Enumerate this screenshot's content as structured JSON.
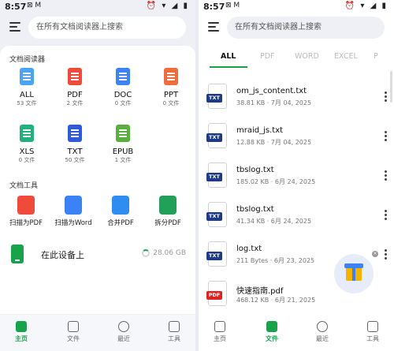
{
  "left": {
    "status": {
      "time": "8:57",
      "indicators": "⊠ M",
      "icons": "⏰ ▾ ◢ ▮"
    },
    "search_placeholder": "在所有文档阅读器上搜索",
    "readers_title": "文档阅读器",
    "categories": [
      {
        "label": "ALL",
        "count": "53 文件",
        "color": "#4aa3f5",
        "icon": "all-docs-icon"
      },
      {
        "label": "PDF",
        "count": "2 文件",
        "color": "#f04a3a",
        "icon": "pdf-icon"
      },
      {
        "label": "DOC",
        "count": "0 文件",
        "color": "#3b82f6",
        "icon": "doc-icon"
      },
      {
        "label": "PPT",
        "count": "0 文件",
        "color": "#f26b3a",
        "icon": "ppt-icon"
      },
      {
        "label": "XLS",
        "count": "0 文件",
        "color": "#22b07d",
        "icon": "xls-icon"
      },
      {
        "label": "TXT",
        "count": "50 文件",
        "color": "#2f5bd6",
        "icon": "txt-icon"
      },
      {
        "label": "EPUB",
        "count": "1 文件",
        "color": "#56b03a",
        "icon": "epub-icon"
      }
    ],
    "tools_title": "文档工具",
    "tools": [
      {
        "label": "扫描为PDF",
        "color": "#f04a3a",
        "icon": "scan-pdf-icon"
      },
      {
        "label": "扫描为Word",
        "color": "#3b82f6",
        "icon": "scan-word-icon"
      },
      {
        "label": "合并PDF",
        "color": "#2f8cf0",
        "icon": "merge-pdf-icon"
      },
      {
        "label": "拆分PDF",
        "color": "#22a05a",
        "icon": "split-pdf-icon"
      }
    ],
    "device": {
      "label": "在此设备上",
      "size": "28.06 GB"
    },
    "nav": [
      {
        "label": "主页",
        "active": true
      },
      {
        "label": "文件",
        "active": false
      },
      {
        "label": "最近",
        "active": false
      },
      {
        "label": "工具",
        "active": false
      }
    ]
  },
  "right": {
    "status": {
      "time": "8:57",
      "indicators": "⊠ M",
      "icons": "⏰ ▾ ◢ ▮"
    },
    "search_placeholder": "在所有文档阅读器上搜索",
    "tabs": [
      "ALL",
      "PDF",
      "WORD",
      "EXCEL",
      "P"
    ],
    "files": [
      {
        "name": "om_js_content.txt",
        "meta": "38.81 KB · 7月 04, 2025",
        "type": "TXT",
        "color": "#1e3a8a"
      },
      {
        "name": "mraid_js.txt",
        "meta": "12.88 KB · 7月 04, 2025",
        "type": "TXT",
        "color": "#1e3a8a"
      },
      {
        "name": "tbslog.txt",
        "meta": "185.02 KB · 6月 24, 2025",
        "type": "TXT",
        "color": "#1e3a8a"
      },
      {
        "name": "tbslog.txt",
        "meta": "41.34 KB · 6月 24, 2025",
        "type": "TXT",
        "color": "#1e3a8a"
      },
      {
        "name": "log.txt",
        "meta": "211 Bytes · 6月 23, 2025",
        "type": "TXT",
        "color": "#1e3a8a"
      },
      {
        "name": "快速指南.pdf",
        "meta": "468.12 KB · 6月 21, 2025",
        "type": "PDF",
        "color": "#e02424"
      }
    ],
    "nav": [
      {
        "label": "主页",
        "active": false
      },
      {
        "label": "文件",
        "active": true
      },
      {
        "label": "最近",
        "active": false
      },
      {
        "label": "工具",
        "active": false
      }
    ]
  },
  "accent": "#16a34a"
}
